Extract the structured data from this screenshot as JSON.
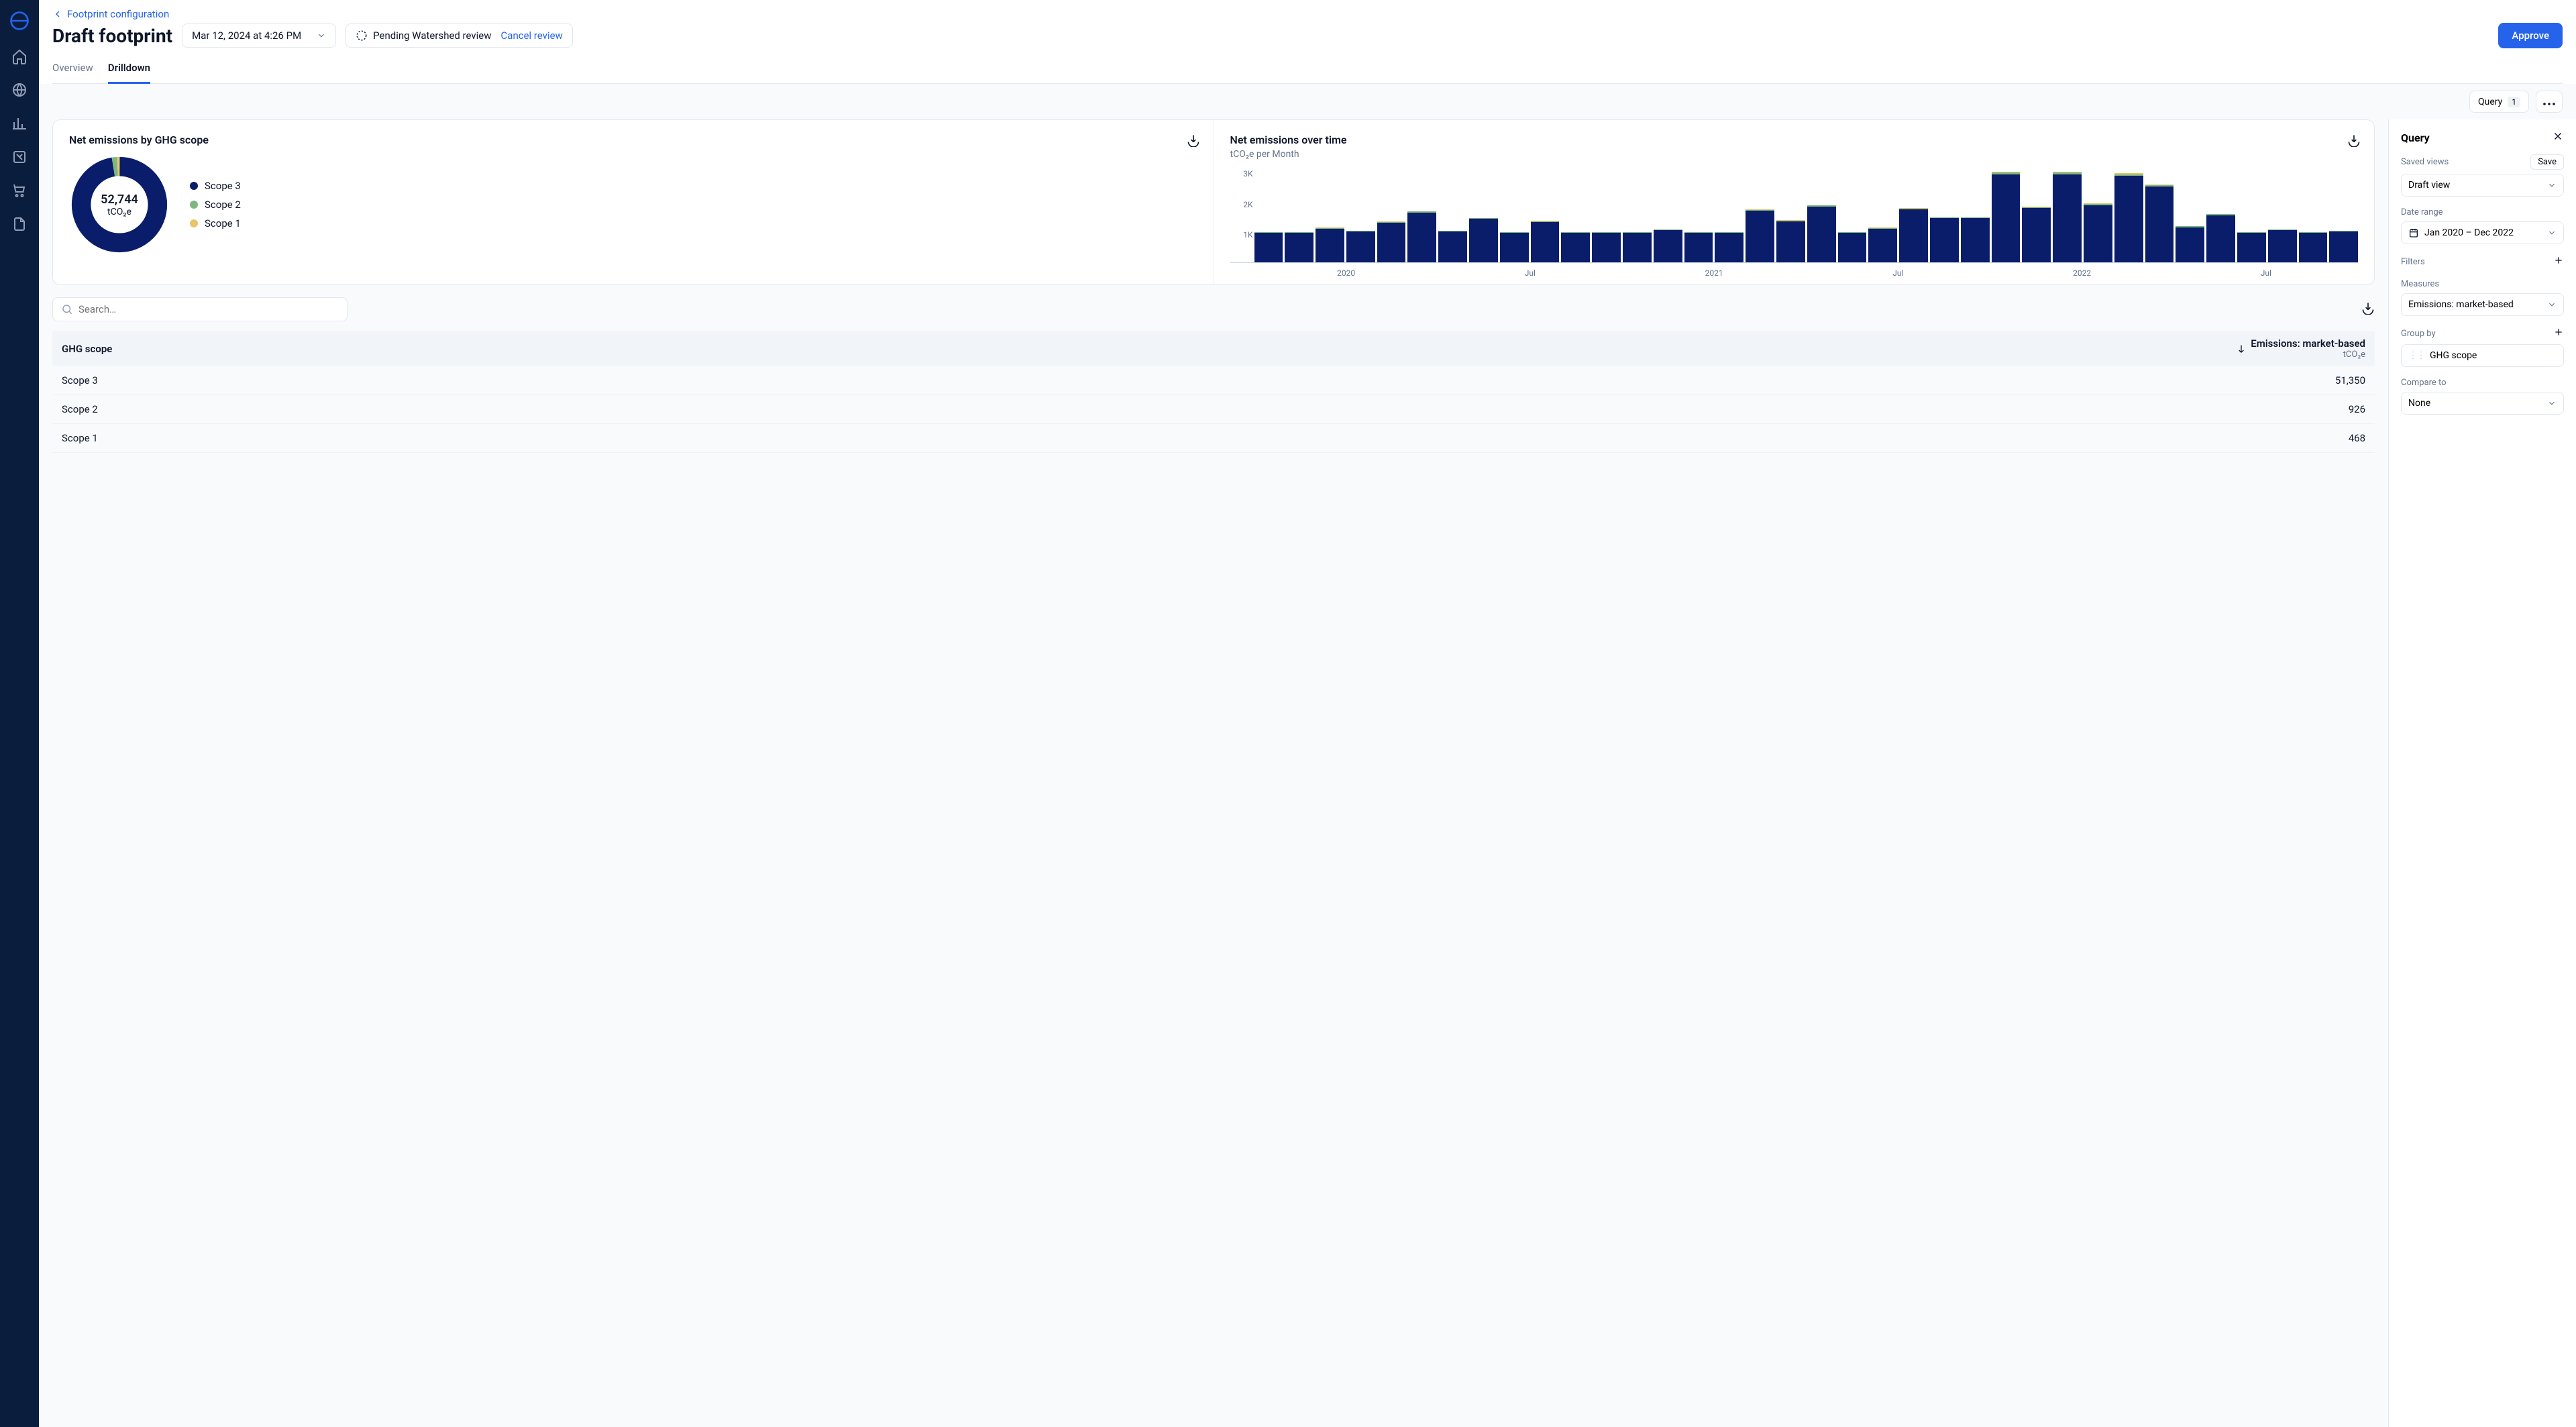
{
  "breadcrumb": "Footprint configuration",
  "page_title": "Draft footprint",
  "version_select": "Mar 12, 2024 at 4:26 PM",
  "status_label": "Pending Watershed review",
  "cancel_label": "Cancel review",
  "approve_label": "Approve",
  "tabs": {
    "overview": "Overview",
    "drilldown": "Drilldown"
  },
  "actions": {
    "query_label": "Query",
    "query_count": "1"
  },
  "donut": {
    "title": "Net emissions by GHG scope",
    "total_value": "52,744",
    "total_unit": "tCO₂e",
    "legend": [
      {
        "label": "Scope 3",
        "color": "#0a1d6b"
      },
      {
        "label": "Scope 2",
        "color": "#7fb77e"
      },
      {
        "label": "Scope 1",
        "color": "#e9c46a"
      }
    ]
  },
  "bars": {
    "title": "Net emissions over time",
    "subtitle": "tCO₂e per Month",
    "ylabels": [
      "3K",
      "2K",
      "1K",
      ""
    ],
    "xlabels": [
      "2020",
      "Jul",
      "2021",
      "Jul",
      "2022",
      "Jul"
    ]
  },
  "search_placeholder": "Search…",
  "table": {
    "col1": "GHG scope",
    "col2": "Emissions: market-based",
    "col2_sub": "tCO₂e",
    "rows": [
      {
        "name": "Scope 3",
        "value": "51,350"
      },
      {
        "name": "Scope 2",
        "value": "926"
      },
      {
        "name": "Scope 1",
        "value": "468"
      }
    ]
  },
  "query": {
    "title": "Query",
    "saved_views_label": "Saved views",
    "save_label": "Save",
    "view_value": "Draft view",
    "daterange_label": "Date range",
    "daterange_value": "Jan 2020 – Dec 2022",
    "filters_label": "Filters",
    "measures_label": "Measures",
    "measure_value": "Emissions: market-based",
    "groupby_label": "Group by",
    "groupby_value": "GHG scope",
    "compare_label": "Compare to",
    "compare_value": "None"
  },
  "chart_data": [
    {
      "type": "pie",
      "title": "Net emissions by GHG scope",
      "unit": "tCO₂e",
      "total": 52744,
      "series": [
        {
          "name": "Scope 3",
          "value": 51350,
          "color": "#0a1d6b"
        },
        {
          "name": "Scope 2",
          "value": 926,
          "color": "#7fb77e"
        },
        {
          "name": "Scope 1",
          "value": 468,
          "color": "#e9c46a"
        }
      ]
    },
    {
      "type": "bar",
      "title": "Net emissions over time",
      "ylabel": "tCO₂e per Month",
      "ylim": [
        0,
        3200
      ],
      "yticks": [
        1000,
        2000,
        3000
      ],
      "x": [
        "2020-01",
        "2020-02",
        "2020-03",
        "2020-04",
        "2020-05",
        "2020-06",
        "2020-07",
        "2020-08",
        "2020-09",
        "2020-10",
        "2020-11",
        "2020-12",
        "2021-01",
        "2021-02",
        "2021-03",
        "2021-04",
        "2021-05",
        "2021-06",
        "2021-07",
        "2021-08",
        "2021-09",
        "2021-10",
        "2021-11",
        "2021-12",
        "2022-01",
        "2022-02",
        "2022-03",
        "2022-04",
        "2022-05",
        "2022-06",
        "2022-07",
        "2022-08",
        "2022-09",
        "2022-10",
        "2022-11",
        "2022-12"
      ],
      "xticks": [
        "2020",
        "Jul",
        "2021",
        "Jul",
        "2022",
        "Jul"
      ],
      "series": [
        {
          "name": "Scope 3",
          "color": "#0a1d6b",
          "values": [
            1000,
            1000,
            1150,
            1050,
            1350,
            1700,
            1050,
            1480,
            1000,
            1380,
            1000,
            1000,
            1000,
            1100,
            1000,
            1000,
            1750,
            1400,
            1900,
            1000,
            1150,
            1800,
            1500,
            1500,
            3000,
            1850,
            3000,
            1950,
            2950,
            2580,
            1200,
            1610,
            1000,
            1100,
            1000,
            1050
          ]
        },
        {
          "name": "Scope 2",
          "color": "#7fb77e",
          "values": [
            20,
            20,
            25,
            20,
            25,
            30,
            20,
            25,
            20,
            25,
            20,
            20,
            20,
            20,
            20,
            20,
            30,
            25,
            35,
            20,
            20,
            30,
            25,
            25,
            55,
            35,
            55,
            40,
            55,
            50,
            25,
            30,
            20,
            20,
            20,
            20
          ]
        },
        {
          "name": "Scope 1",
          "color": "#e9c46a",
          "values": [
            10,
            10,
            12,
            10,
            12,
            15,
            10,
            12,
            10,
            12,
            10,
            10,
            10,
            10,
            10,
            10,
            15,
            12,
            18,
            10,
            10,
            15,
            12,
            12,
            28,
            18,
            28,
            20,
            28,
            25,
            12,
            15,
            10,
            10,
            10,
            10
          ]
        }
      ]
    }
  ]
}
